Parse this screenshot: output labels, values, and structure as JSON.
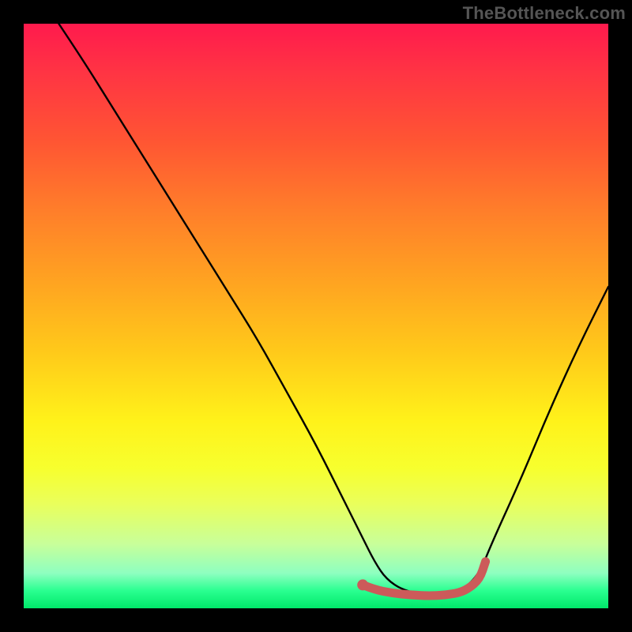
{
  "watermark": "TheBottleneck.com",
  "chart_data": {
    "type": "line",
    "title": "",
    "xlabel": "",
    "ylabel": "",
    "xlim": [
      0,
      100
    ],
    "ylim": [
      0,
      100
    ],
    "grid": false,
    "legend": false,
    "series": [
      {
        "name": "bottleneck-curve",
        "color": "#000000",
        "x": [
          6,
          10,
          15,
          20,
          25,
          30,
          35,
          40,
          45,
          50,
          55,
          58,
          60,
          62,
          65,
          70,
          75,
          78,
          80,
          85,
          90,
          95,
          100
        ],
        "y": [
          100,
          94,
          86,
          78,
          70,
          62,
          54,
          46,
          37,
          28,
          18,
          12,
          8,
          5,
          3,
          2,
          3,
          6,
          11,
          22,
          34,
          45,
          55
        ]
      },
      {
        "name": "optimal-range-marker",
        "color": "#cc5a5a",
        "x": [
          58,
          60,
          63,
          66,
          70,
          74,
          76,
          78,
          79
        ],
        "y": [
          4.0,
          3.2,
          2.6,
          2.3,
          2.1,
          2.5,
          3.3,
          5.0,
          8.0
        ]
      }
    ],
    "points": [
      {
        "name": "optimal-start-dot",
        "x": 58,
        "y": 4.0,
        "color": "#cc5a5a"
      }
    ],
    "gradient_stops": [
      {
        "pos": 0,
        "color": "#ff1a4d"
      },
      {
        "pos": 8,
        "color": "#ff3344"
      },
      {
        "pos": 20,
        "color": "#ff5533"
      },
      {
        "pos": 32,
        "color": "#ff7e2a"
      },
      {
        "pos": 44,
        "color": "#ffa321"
      },
      {
        "pos": 56,
        "color": "#ffc91a"
      },
      {
        "pos": 68,
        "color": "#fff21a"
      },
      {
        "pos": 76,
        "color": "#f7ff2e"
      },
      {
        "pos": 82,
        "color": "#eaff5a"
      },
      {
        "pos": 89,
        "color": "#c8ff9a"
      },
      {
        "pos": 94,
        "color": "#8effc0"
      },
      {
        "pos": 97,
        "color": "#2aff90"
      },
      {
        "pos": 100,
        "color": "#00e86a"
      }
    ]
  }
}
